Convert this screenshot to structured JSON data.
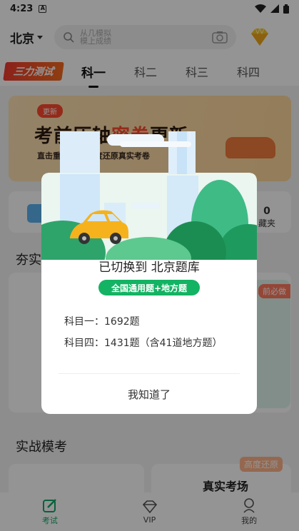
{
  "status_bar": {
    "time": "4:23",
    "notification_icon": "A"
  },
  "header": {
    "city": "北京",
    "search_placeholder_line1": "从几模拟",
    "search_placeholder_line2": "模上成绩"
  },
  "tabs": {
    "brand": "三力测试",
    "items": [
      "科一",
      "科二",
      "科三",
      "科四"
    ],
    "active": 0
  },
  "banner": {
    "tag": "更新",
    "title_pre": "考前压轴",
    "title_accent": "密卷",
    "title_post": "更新",
    "subtitle": "直击重难考点 高度还原真实考卷"
  },
  "card_row": {
    "right_value": "0",
    "right_label": "藏夹"
  },
  "sections": {
    "first_title": "夯实",
    "practice_badge": "前必做",
    "mock_title": "实战模考",
    "mock_card_title": "真实考场",
    "mock_card_badge": "高度还原"
  },
  "dialog": {
    "title": "已切换到 北京题库",
    "tag": "全国通用题+地方题",
    "line1": "科目一：1692题",
    "line2": "科目四：1431题（含41道地方题）",
    "confirm": "我知道了"
  },
  "bottom_nav": {
    "items": [
      "考试",
      "VIP",
      "我的"
    ],
    "active": 0
  },
  "colors": {
    "accent_green": "#13b363",
    "brand_red": "#f23b2e"
  }
}
